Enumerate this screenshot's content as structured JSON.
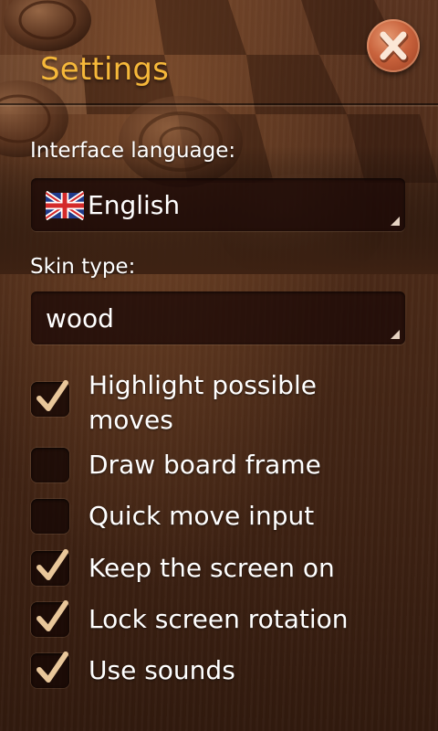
{
  "header": {
    "title": "Settings",
    "close_icon": "close-x-icon"
  },
  "language": {
    "label": "Interface language:",
    "value": "English",
    "flag_icon": "uk-flag-icon"
  },
  "skin": {
    "label": "Skin type:",
    "value": "wood"
  },
  "options": [
    {
      "label": "Highlight possible moves",
      "checked": true
    },
    {
      "label": "Draw board frame",
      "checked": false
    },
    {
      "label": "Quick move input",
      "checked": false
    },
    {
      "label": "Keep the screen on",
      "checked": true
    },
    {
      "label": "Lock screen rotation",
      "checked": true
    },
    {
      "label": "Use sounds",
      "checked": true
    }
  ],
  "colors": {
    "title": "#f6b83a",
    "checkmark": "#e9c79a",
    "close_button": "#c8623c"
  }
}
